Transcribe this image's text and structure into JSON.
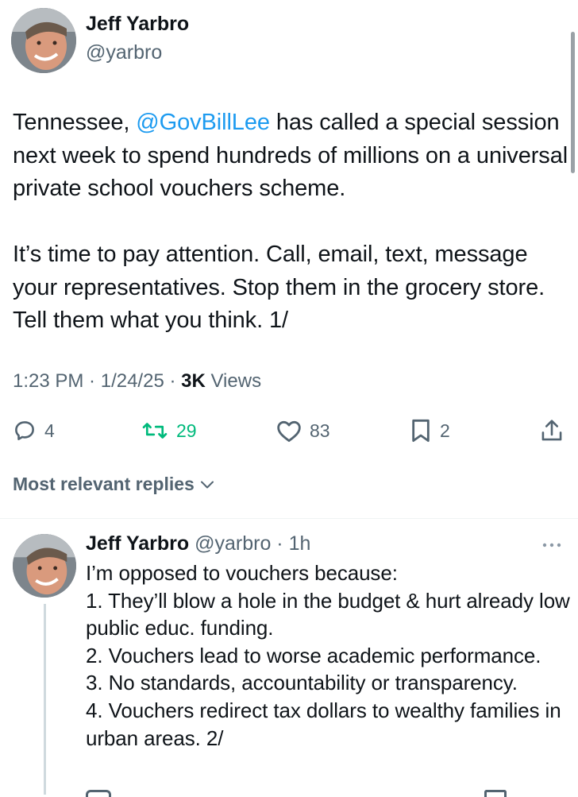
{
  "tweet": {
    "author_name": "Jeff Yarbro",
    "author_handle": "@yarbro",
    "text_before_mention": "Tennessee, ",
    "mention": "@GovBillLee",
    "text_after_mention": " has called a special session next week to spend hundreds of millions on a universal private school vouchers scheme.\n\nIt’s time to pay attention. Call, email, text, message your representatives. Stop them in the grocery store. Tell them what you think. 1/",
    "time": "1:23 PM",
    "date": "1/24/25",
    "separator": " · ",
    "views_count": "3K",
    "views_label": "Views"
  },
  "actions": {
    "replies": "4",
    "retweets": "29",
    "likes": "83",
    "bookmarks": "2",
    "icons": [
      "reply-icon",
      "retweet-icon",
      "like-icon",
      "bookmark-icon",
      "share-icon"
    ]
  },
  "replies_filter": {
    "label": "Most relevant replies"
  },
  "reply": {
    "author_name": "Jeff Yarbro",
    "author_handle": "@yarbro",
    "separator": " · ",
    "age": "1h",
    "text": "I’m opposed to vouchers because:\n1. They’ll blow a hole in the budget & hurt already low public educ. funding.\n2. Vouchers lead to worse academic performance.\n3. No standards, accountability or transparency.\n4. Vouchers redirect tax dollars to wealthy families in urban areas. 2/"
  },
  "colors": {
    "text": "#0f1419",
    "secondary": "#536471",
    "accent": "#1d9bf0",
    "retweet": "#00ba7c"
  }
}
